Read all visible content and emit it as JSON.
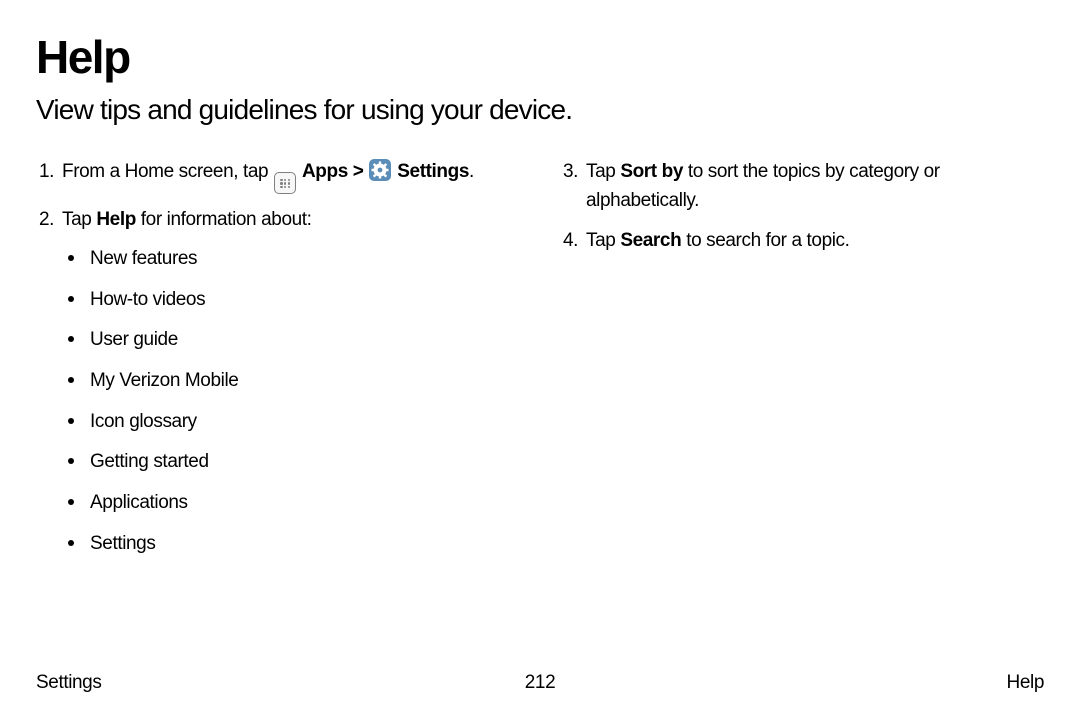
{
  "title": "Help",
  "subtitle": "View tips and guidelines for using your device.",
  "steps": {
    "s1": {
      "num": "1.",
      "pre": "From a Home screen, tap ",
      "apps": "Apps",
      "sep": " > ",
      "settings": "Settings",
      "post": "."
    },
    "s2": {
      "num": "2.",
      "pre": "Tap ",
      "bold": "Help",
      "post": " for information about:"
    },
    "s3": {
      "num": "3.",
      "pre": "Tap ",
      "bold": "Sort by",
      "post": " to sort the topics by category or alphabetically."
    },
    "s4": {
      "num": "4.",
      "pre": "Tap ",
      "bold": "Search",
      "post": " to search for a topic."
    }
  },
  "bullets": [
    "New features",
    "How-to videos",
    "User guide",
    "My Verizon Mobile",
    "Icon glossary",
    "Getting started",
    "Applications",
    "Settings"
  ],
  "footer": {
    "left": "Settings",
    "center": "212",
    "right": "Help"
  }
}
